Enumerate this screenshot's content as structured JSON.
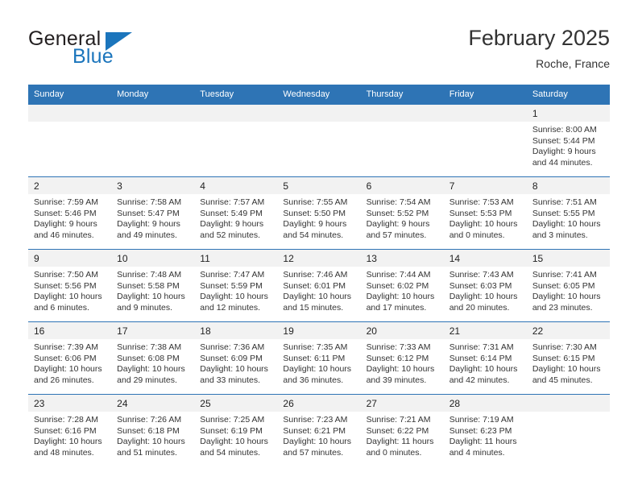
{
  "brand": {
    "name_part1": "General",
    "name_part2": "Blue",
    "logo_icon": "triangle-flag-icon",
    "color_primary": "#1b75bc",
    "color_text": "#231f20"
  },
  "header": {
    "title": "February 2025",
    "location": "Roche, France"
  },
  "theme": {
    "header_row_bg": "#2e74b5",
    "daynum_bg": "#f2f2f2",
    "text": "#333333"
  },
  "weekdays": [
    "Sunday",
    "Monday",
    "Tuesday",
    "Wednesday",
    "Thursday",
    "Friday",
    "Saturday"
  ],
  "weeks": [
    {
      "days": [
        {
          "num": "",
          "empty": true,
          "sunrise": "",
          "sunset": "",
          "daylight": ""
        },
        {
          "num": "",
          "empty": true,
          "sunrise": "",
          "sunset": "",
          "daylight": ""
        },
        {
          "num": "",
          "empty": true,
          "sunrise": "",
          "sunset": "",
          "daylight": ""
        },
        {
          "num": "",
          "empty": true,
          "sunrise": "",
          "sunset": "",
          "daylight": ""
        },
        {
          "num": "",
          "empty": true,
          "sunrise": "",
          "sunset": "",
          "daylight": ""
        },
        {
          "num": "",
          "empty": true,
          "sunrise": "",
          "sunset": "",
          "daylight": ""
        },
        {
          "num": "1",
          "empty": false,
          "sunrise": "Sunrise: 8:00 AM",
          "sunset": "Sunset: 5:44 PM",
          "daylight": "Daylight: 9 hours and 44 minutes."
        }
      ]
    },
    {
      "days": [
        {
          "num": "2",
          "empty": false,
          "sunrise": "Sunrise: 7:59 AM",
          "sunset": "Sunset: 5:46 PM",
          "daylight": "Daylight: 9 hours and 46 minutes."
        },
        {
          "num": "3",
          "empty": false,
          "sunrise": "Sunrise: 7:58 AM",
          "sunset": "Sunset: 5:47 PM",
          "daylight": "Daylight: 9 hours and 49 minutes."
        },
        {
          "num": "4",
          "empty": false,
          "sunrise": "Sunrise: 7:57 AM",
          "sunset": "Sunset: 5:49 PM",
          "daylight": "Daylight: 9 hours and 52 minutes."
        },
        {
          "num": "5",
          "empty": false,
          "sunrise": "Sunrise: 7:55 AM",
          "sunset": "Sunset: 5:50 PM",
          "daylight": "Daylight: 9 hours and 54 minutes."
        },
        {
          "num": "6",
          "empty": false,
          "sunrise": "Sunrise: 7:54 AM",
          "sunset": "Sunset: 5:52 PM",
          "daylight": "Daylight: 9 hours and 57 minutes."
        },
        {
          "num": "7",
          "empty": false,
          "sunrise": "Sunrise: 7:53 AM",
          "sunset": "Sunset: 5:53 PM",
          "daylight": "Daylight: 10 hours and 0 minutes."
        },
        {
          "num": "8",
          "empty": false,
          "sunrise": "Sunrise: 7:51 AM",
          "sunset": "Sunset: 5:55 PM",
          "daylight": "Daylight: 10 hours and 3 minutes."
        }
      ]
    },
    {
      "days": [
        {
          "num": "9",
          "empty": false,
          "sunrise": "Sunrise: 7:50 AM",
          "sunset": "Sunset: 5:56 PM",
          "daylight": "Daylight: 10 hours and 6 minutes."
        },
        {
          "num": "10",
          "empty": false,
          "sunrise": "Sunrise: 7:48 AM",
          "sunset": "Sunset: 5:58 PM",
          "daylight": "Daylight: 10 hours and 9 minutes."
        },
        {
          "num": "11",
          "empty": false,
          "sunrise": "Sunrise: 7:47 AM",
          "sunset": "Sunset: 5:59 PM",
          "daylight": "Daylight: 10 hours and 12 minutes."
        },
        {
          "num": "12",
          "empty": false,
          "sunrise": "Sunrise: 7:46 AM",
          "sunset": "Sunset: 6:01 PM",
          "daylight": "Daylight: 10 hours and 15 minutes."
        },
        {
          "num": "13",
          "empty": false,
          "sunrise": "Sunrise: 7:44 AM",
          "sunset": "Sunset: 6:02 PM",
          "daylight": "Daylight: 10 hours and 17 minutes."
        },
        {
          "num": "14",
          "empty": false,
          "sunrise": "Sunrise: 7:43 AM",
          "sunset": "Sunset: 6:03 PM",
          "daylight": "Daylight: 10 hours and 20 minutes."
        },
        {
          "num": "15",
          "empty": false,
          "sunrise": "Sunrise: 7:41 AM",
          "sunset": "Sunset: 6:05 PM",
          "daylight": "Daylight: 10 hours and 23 minutes."
        }
      ]
    },
    {
      "days": [
        {
          "num": "16",
          "empty": false,
          "sunrise": "Sunrise: 7:39 AM",
          "sunset": "Sunset: 6:06 PM",
          "daylight": "Daylight: 10 hours and 26 minutes."
        },
        {
          "num": "17",
          "empty": false,
          "sunrise": "Sunrise: 7:38 AM",
          "sunset": "Sunset: 6:08 PM",
          "daylight": "Daylight: 10 hours and 29 minutes."
        },
        {
          "num": "18",
          "empty": false,
          "sunrise": "Sunrise: 7:36 AM",
          "sunset": "Sunset: 6:09 PM",
          "daylight": "Daylight: 10 hours and 33 minutes."
        },
        {
          "num": "19",
          "empty": false,
          "sunrise": "Sunrise: 7:35 AM",
          "sunset": "Sunset: 6:11 PM",
          "daylight": "Daylight: 10 hours and 36 minutes."
        },
        {
          "num": "20",
          "empty": false,
          "sunrise": "Sunrise: 7:33 AM",
          "sunset": "Sunset: 6:12 PM",
          "daylight": "Daylight: 10 hours and 39 minutes."
        },
        {
          "num": "21",
          "empty": false,
          "sunrise": "Sunrise: 7:31 AM",
          "sunset": "Sunset: 6:14 PM",
          "daylight": "Daylight: 10 hours and 42 minutes."
        },
        {
          "num": "22",
          "empty": false,
          "sunrise": "Sunrise: 7:30 AM",
          "sunset": "Sunset: 6:15 PM",
          "daylight": "Daylight: 10 hours and 45 minutes."
        }
      ]
    },
    {
      "days": [
        {
          "num": "23",
          "empty": false,
          "sunrise": "Sunrise: 7:28 AM",
          "sunset": "Sunset: 6:16 PM",
          "daylight": "Daylight: 10 hours and 48 minutes."
        },
        {
          "num": "24",
          "empty": false,
          "sunrise": "Sunrise: 7:26 AM",
          "sunset": "Sunset: 6:18 PM",
          "daylight": "Daylight: 10 hours and 51 minutes."
        },
        {
          "num": "25",
          "empty": false,
          "sunrise": "Sunrise: 7:25 AM",
          "sunset": "Sunset: 6:19 PM",
          "daylight": "Daylight: 10 hours and 54 minutes."
        },
        {
          "num": "26",
          "empty": false,
          "sunrise": "Sunrise: 7:23 AM",
          "sunset": "Sunset: 6:21 PM",
          "daylight": "Daylight: 10 hours and 57 minutes."
        },
        {
          "num": "27",
          "empty": false,
          "sunrise": "Sunrise: 7:21 AM",
          "sunset": "Sunset: 6:22 PM",
          "daylight": "Daylight: 11 hours and 0 minutes."
        },
        {
          "num": "28",
          "empty": false,
          "sunrise": "Sunrise: 7:19 AM",
          "sunset": "Sunset: 6:23 PM",
          "daylight": "Daylight: 11 hours and 4 minutes."
        },
        {
          "num": "",
          "empty": true,
          "sunrise": "",
          "sunset": "",
          "daylight": ""
        }
      ]
    }
  ]
}
